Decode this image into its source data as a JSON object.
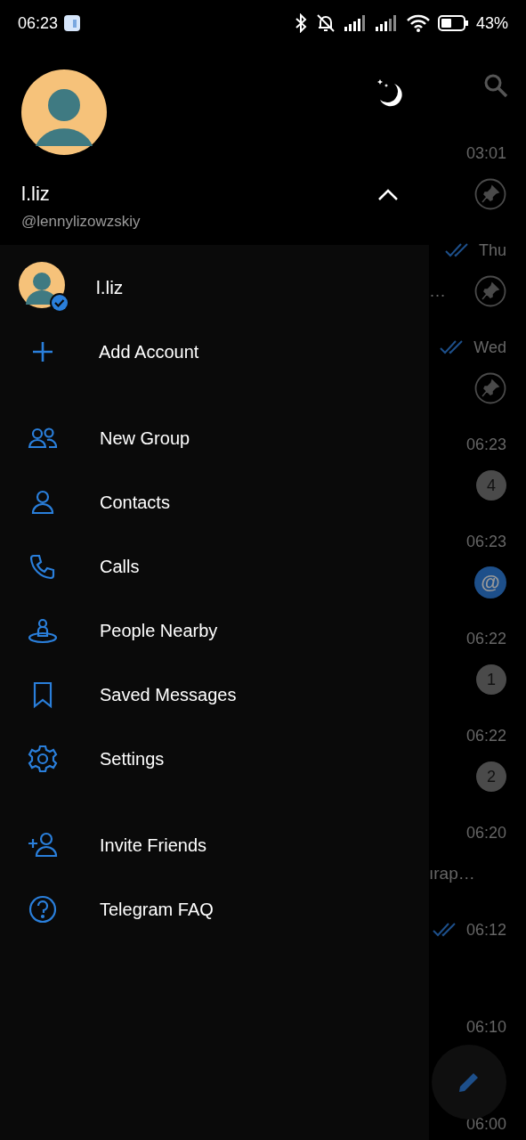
{
  "status_bar": {
    "time": "06:23",
    "battery": "43%"
  },
  "header": {
    "name": "l.liz",
    "username": "@lennylizowzskiy",
    "expanded": true
  },
  "accounts": [
    {
      "name": "l.liz",
      "selected": true
    }
  ],
  "add_account": {
    "label": "Add Account"
  },
  "menu_items": [
    {
      "kind": "group",
      "label": "New Group"
    },
    {
      "kind": "contact",
      "label": "Contacts"
    },
    {
      "kind": "call",
      "label": "Calls"
    },
    {
      "kind": "nearby",
      "label": "People Nearby"
    },
    {
      "kind": "saved",
      "label": "Saved Messages"
    },
    {
      "kind": "settings",
      "label": "Settings"
    }
  ],
  "extra_items": [
    {
      "kind": "invite",
      "label": "Invite Friends"
    },
    {
      "kind": "faq",
      "label": "Telegram FAQ"
    }
  ],
  "chat_list": [
    {
      "time": "03:01",
      "read": false,
      "badge": {
        "kind": "pin"
      }
    },
    {
      "time": "Thu",
      "read": true,
      "preview": "…",
      "badge": {
        "kind": "pin"
      }
    },
    {
      "time": "Wed",
      "read": true,
      "badge": {
        "kind": "pin"
      }
    },
    {
      "time": "06:23",
      "read": false,
      "badge": {
        "kind": "count",
        "text": "4"
      }
    },
    {
      "time": "06:23",
      "read": false,
      "badge": {
        "kind": "mention",
        "text": "@"
      }
    },
    {
      "time": "06:22",
      "read": false,
      "badge": {
        "kind": "count",
        "text": "1"
      }
    },
    {
      "time": "06:22",
      "read": false,
      "badge": {
        "kind": "count",
        "text": "2"
      }
    },
    {
      "time": "06:20",
      "read": false,
      "preview": "ırap…"
    },
    {
      "time": "06:12",
      "read": true
    },
    {
      "time": "06:10",
      "read": false
    },
    {
      "time": "06:00",
      "read": false
    }
  ]
}
